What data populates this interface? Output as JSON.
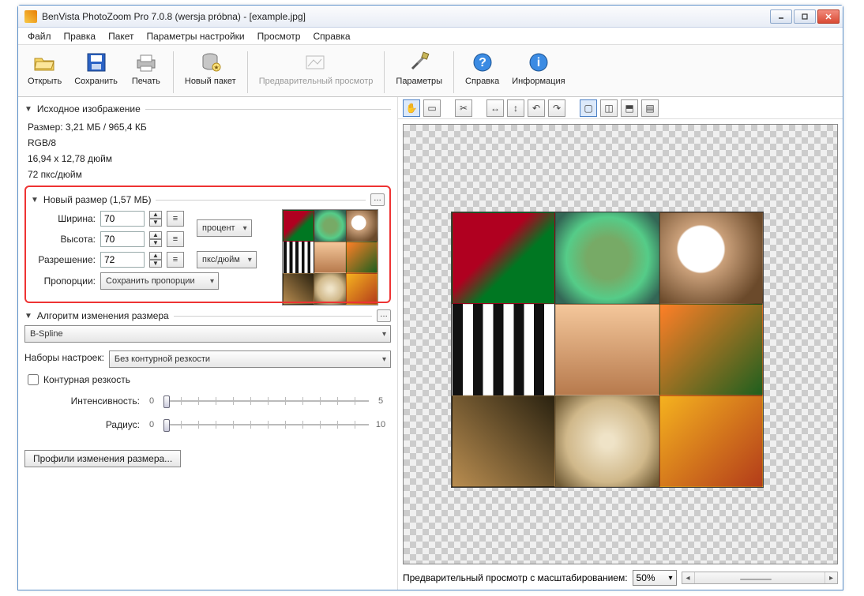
{
  "title": "BenVista PhotoZoom Pro 7.0.8 (wersja próbna) - [example.jpg]",
  "menu": [
    "Файл",
    "Правка",
    "Пакет",
    "Параметры настройки",
    "Просмотр",
    "Справка"
  ],
  "toolbar": {
    "open": "Открыть",
    "save": "Сохранить",
    "print": "Печать",
    "newbatch": "Новый пакет",
    "preview": "Предварительный просмотр",
    "params": "Параметры",
    "help": "Справка",
    "info": "Информация"
  },
  "sections": {
    "source_title": "Исходное изображение",
    "source_info": [
      "Размер: 3,21 МБ / 965,4 КБ",
      "RGB/8",
      "16,94 x 12,78 дюйм",
      "72 пкс/дюйм"
    ],
    "newsize_title": "Новый размер (1,57 МБ)",
    "width_label": "Ширина:",
    "height_label": "Высота:",
    "res_label": "Разрешение:",
    "aspect_label": "Пропорции:",
    "width_val": "70",
    "height_val": "70",
    "res_val": "72",
    "unit_size": "процент",
    "unit_res": "пкс/дюйм",
    "aspect_val": "Сохранить пропорции",
    "algo_title": "Алгоритм изменения размера",
    "algo_val": "B-Spline",
    "presets_label": "Наборы настроек:",
    "presets_val": "Без контурной резкости",
    "sharp_chk": "Контурная резкость",
    "intensity_label": "Интенсивность:",
    "intensity_min": "0",
    "intensity_max": "5",
    "radius_label": "Радиус:",
    "radius_min": "0",
    "radius_max": "10",
    "profiles_btn": "Профили изменения размера..."
  },
  "preview": {
    "zoom_label": "Предварительный просмотр с масштабированием:",
    "zoom_val": "50%"
  }
}
